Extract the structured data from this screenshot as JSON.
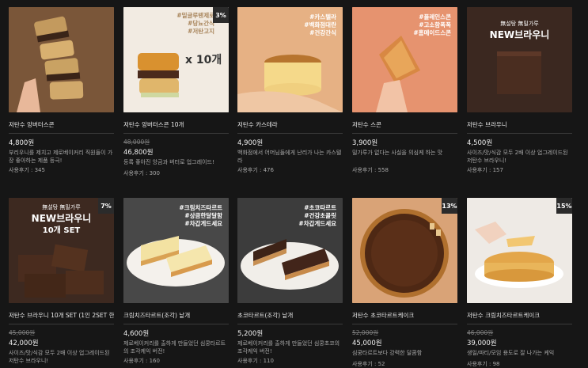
{
  "products": [
    {
      "title": "저탄수 앙버터스콘",
      "price": "4,800원",
      "original_price": "",
      "description": "부리우니를 제치고 제로베이커리 직원들이 가장 좋아하는 제품 등극!",
      "review": "사용후기 : 345",
      "badge": "",
      "tags": []
    },
    {
      "title": "저탄수 앙버터스콘 10개",
      "price": "46,800원",
      "original_price": "48,000원",
      "description": "등록 좋아진 앙금과 버터로 업그레이드!",
      "review": "사용후기 : 300",
      "badge": "3%",
      "tags": [
        "#밀글루텐제로",
        "#당뇨간식",
        "#저탄고지"
      ],
      "overlay": "x 10개"
    },
    {
      "title": "저탄수 카스테라",
      "price": "4,900원",
      "original_price": "",
      "description": "백화점에서 어머님들에게 난리가 나는 카스텔라",
      "review": "사용후기 : 476",
      "badge": "",
      "tags": [
        "#카스텔라",
        "#백화점대란",
        "#건강간식"
      ]
    },
    {
      "title": "저탄수 스콘",
      "price": "3,900원",
      "original_price": "",
      "description": "밀가루가 없다는 사실을 의심케 하는 맛",
      "review": "사용후기 : 558",
      "badge": "",
      "tags": [
        "#플레인스콘",
        "#고소함폭폭",
        "#홈메이드스콘"
      ]
    },
    {
      "title": "저탄수 브라우니",
      "price": "4,500원",
      "original_price": "",
      "description": "사이즈/맛/식감 모두 2배 이상 업그레이드된 저탄수 브라우니!",
      "review": "사용후기 : 157",
      "badge": "",
      "tags": [],
      "overlay_small": "無설탕 無밀가루",
      "overlay": "NEW브라우니"
    },
    {
      "title": "저탄수 브라우니 10개 SET (1인 2SET 한정)",
      "price": "42,000원",
      "original_price": "45,000원",
      "description": "사이즈/맛/식감 모두 2배 이상 업그레이드된 저탄수 브라우니!",
      "review": "",
      "badge": "7%",
      "tags": [],
      "overlay_small": "無설탕 無밀가루",
      "overlay": "NEW브라우니",
      "overlay2": "10개 SET"
    },
    {
      "title": "크림치즈타르트(조각) 낱개",
      "price": "4,600원",
      "original_price": "",
      "description": "제로베이커리를 출하게 만들었던 심쿵타르트의 조각케익 버전!",
      "review": "사용후기 : 160",
      "badge": "",
      "tags": [
        "#크림치즈타르트",
        "#상큼한달달함",
        "#차갑게드세요"
      ]
    },
    {
      "title": "초코타르트(조각) 낱개",
      "price": "5,200원",
      "original_price": "",
      "description": "제로베이커리를 출하게 만들었던 심쿵초코의 조각케익 버전!",
      "review": "사용후기 : 110",
      "badge": "",
      "tags": [
        "#초코타르트",
        "#건강초콜릿",
        "#차갑게드세요"
      ]
    },
    {
      "title": "저탄수 초코타르트케이크",
      "price": "45,000원",
      "original_price": "52,000원",
      "description": "심쿵타르트보다 강력한 달콤함",
      "review": "사용후기 : 52",
      "badge": "13%",
      "tags": []
    },
    {
      "title": "저탄수 크림치즈타르트케이크",
      "price": "39,000원",
      "original_price": "46,000원",
      "description": "생일/파티/모임 용도로 잘 나가는 케익",
      "review": "사용후기 : 98",
      "badge": "15%",
      "tags": []
    }
  ]
}
